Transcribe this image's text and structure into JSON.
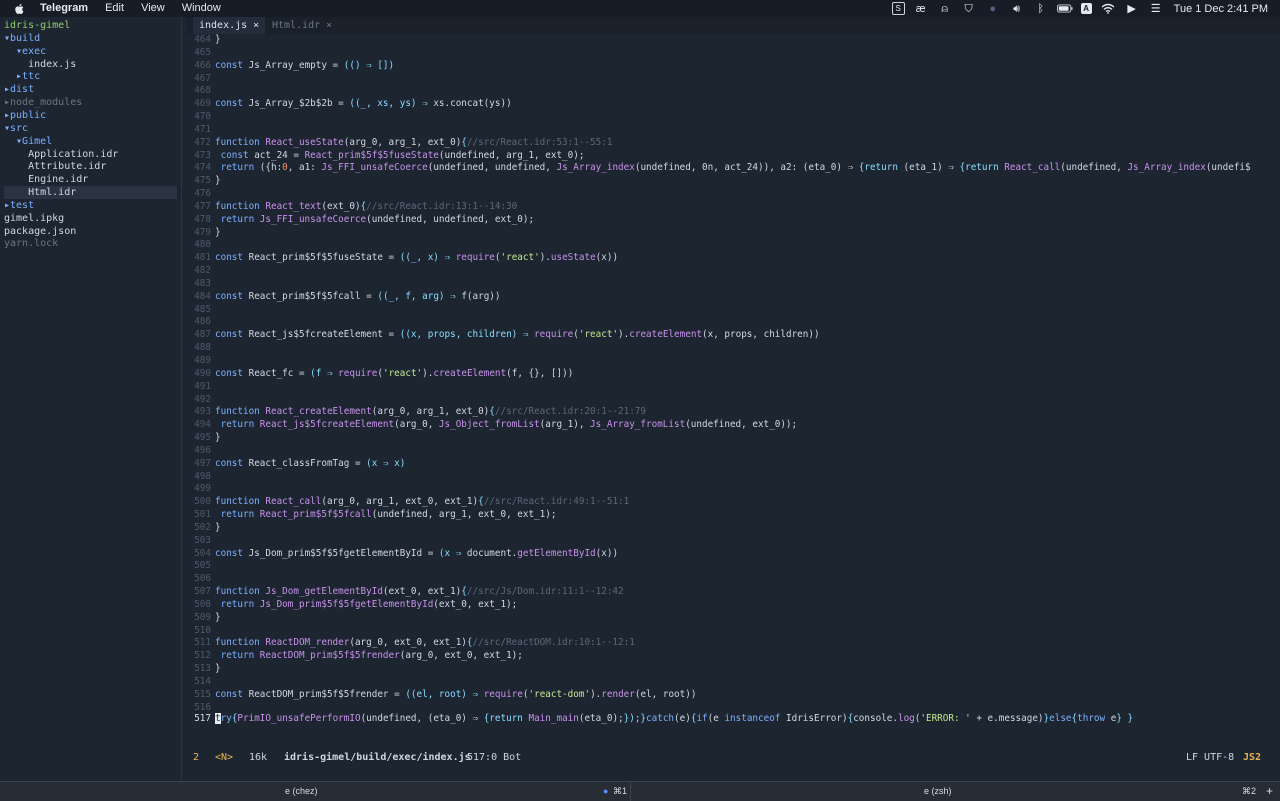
{
  "menubar": {
    "app_name": "Telegram",
    "menus": [
      "Edit",
      "View",
      "Window"
    ],
    "status_icons": [
      "terminal-icon",
      "ae-icon",
      "vpn-icon",
      "shield-icon",
      "circle-icon",
      "volume-icon",
      "bluetooth-icon",
      "battery-icon",
      "input-source-icon",
      "wifi-icon",
      "play-icon",
      "control-center-icon"
    ],
    "clock": "Tue 1 Dec  2:41 PM"
  },
  "sidebar": {
    "items": [
      {
        "label": "idris-gimel",
        "color": "#8fd16b"
      },
      {
        "label": "▾build",
        "color": "#7cb0ff"
      },
      {
        "label": "  ▾exec",
        "color": "#7cb0ff"
      },
      {
        "label": "    index.js",
        "color": "#d1d8e2"
      },
      {
        "label": "  ▸ttc",
        "color": "#7cb0ff"
      },
      {
        "label": "▸dist",
        "color": "#7cb0ff"
      },
      {
        "label": "▸node_modules",
        "color": "#6a7585"
      },
      {
        "label": "▸public",
        "color": "#7cb0ff"
      },
      {
        "label": "▾src",
        "color": "#7cb0ff"
      },
      {
        "label": "  ▾Gimel",
        "color": "#7cb0ff"
      },
      {
        "label": "    Application.idr",
        "color": "#d1d8e2"
      },
      {
        "label": "    Attribute.idr",
        "color": "#d1d8e2"
      },
      {
        "label": "    Engine.idr",
        "color": "#d1d8e2"
      },
      {
        "label": "    Html.idr",
        "color": "#d1d8e2"
      },
      {
        "label": "▸test",
        "color": "#7cb0ff"
      },
      {
        "label": "gimel.ipkg",
        "color": "#d1d8e2"
      },
      {
        "label": "package.json",
        "color": "#d1d8e2"
      },
      {
        "label": "yarn.lock",
        "color": "#6a7585"
      }
    ]
  },
  "tabs": [
    {
      "label": "index.js ×",
      "active": true
    },
    {
      "label": "Html.idr ×",
      "active": false
    }
  ],
  "editor": {
    "lines": [
      {
        "num": "464",
        "segs": [
          {
            "t": "}",
            "c": "code"
          }
        ]
      },
      {
        "num": "465",
        "segs": []
      },
      {
        "num": "466",
        "segs": [
          {
            "t": "const ",
            "c": "k"
          },
          {
            "t": "Js_Array_empty = ",
            "c": "code"
          },
          {
            "t": "(() ⇒ [])",
            "c": "p"
          }
        ]
      },
      {
        "num": "467",
        "segs": []
      },
      {
        "num": "468",
        "segs": []
      },
      {
        "num": "469",
        "segs": [
          {
            "t": "const ",
            "c": "k"
          },
          {
            "t": "Js_Array_$2b$2b = ",
            "c": "code"
          },
          {
            "t": "((_, xs, ys) ⇒ ",
            "c": "p"
          },
          {
            "t": "xs.concat(ys))",
            "c": "code"
          }
        ]
      },
      {
        "num": "470",
        "segs": []
      },
      {
        "num": "471",
        "segs": []
      },
      {
        "num": "472",
        "segs": [
          {
            "t": "function ",
            "c": "k"
          },
          {
            "t": "React_useState",
            "c": "f"
          },
          {
            "t": "(arg_0, arg_1, ext_0)",
            "c": "code"
          },
          {
            "t": "{",
            "c": "p"
          },
          {
            "t": "//src/React.idr:53:1--55:1",
            "c": "c"
          }
        ]
      },
      {
        "num": "473",
        "segs": [
          {
            "t": " const ",
            "c": "k"
          },
          {
            "t": "act_24 = ",
            "c": "code"
          },
          {
            "t": "React_prim$5f$5fuseState",
            "c": "f"
          },
          {
            "t": "(undefined, arg_1, ext_0);",
            "c": "code"
          }
        ]
      },
      {
        "num": "474",
        "segs": [
          {
            "t": " return ",
            "c": "k"
          },
          {
            "t": "({h:",
            "c": "code"
          },
          {
            "t": "0",
            "c": "n"
          },
          {
            "t": ", a1: ",
            "c": "code"
          },
          {
            "t": "Js_FFI_unsafeCoerce",
            "c": "f"
          },
          {
            "t": "(undefined, undefined, ",
            "c": "code"
          },
          {
            "t": "Js_Array_index",
            "c": "f"
          },
          {
            "t": "(undefined, 0n, act_24)), a2: (eta_0) ⇒ ",
            "c": "code"
          },
          {
            "t": "{return ",
            "c": "p"
          },
          {
            "t": "(eta_1) ⇒ ",
            "c": "code"
          },
          {
            "t": "{return ",
            "c": "p"
          },
          {
            "t": "React_call",
            "c": "f"
          },
          {
            "t": "(undefined, ",
            "c": "code"
          },
          {
            "t": "Js_Array_index",
            "c": "f"
          },
          {
            "t": "(undefi$",
            "c": "code"
          }
        ]
      },
      {
        "num": "475",
        "segs": [
          {
            "t": "}",
            "c": "code"
          }
        ]
      },
      {
        "num": "476",
        "segs": []
      },
      {
        "num": "477",
        "segs": [
          {
            "t": "function ",
            "c": "k"
          },
          {
            "t": "React_text",
            "c": "f"
          },
          {
            "t": "(ext_0)",
            "c": "code"
          },
          {
            "t": "{",
            "c": "p"
          },
          {
            "t": "//src/React.idr:13:1--14:30",
            "c": "c"
          }
        ]
      },
      {
        "num": "478",
        "segs": [
          {
            "t": " return ",
            "c": "k"
          },
          {
            "t": "Js_FFI_unsafeCoerce",
            "c": "f"
          },
          {
            "t": "(undefined, undefined, ext_0);",
            "c": "code"
          }
        ]
      },
      {
        "num": "479",
        "segs": [
          {
            "t": "}",
            "c": "code"
          }
        ]
      },
      {
        "num": "480",
        "segs": []
      },
      {
        "num": "481",
        "segs": [
          {
            "t": "const ",
            "c": "k"
          },
          {
            "t": "React_prim$5f$5fuseState = ",
            "c": "code"
          },
          {
            "t": "((_, x) ⇒ ",
            "c": "p"
          },
          {
            "t": "require",
            "c": "f"
          },
          {
            "t": "(",
            "c": "code"
          },
          {
            "t": "'react'",
            "c": "s"
          },
          {
            "t": ").",
            "c": "code"
          },
          {
            "t": "useState",
            "c": "f"
          },
          {
            "t": "(x))",
            "c": "code"
          }
        ]
      },
      {
        "num": "482",
        "segs": []
      },
      {
        "num": "483",
        "segs": []
      },
      {
        "num": "484",
        "segs": [
          {
            "t": "const ",
            "c": "k"
          },
          {
            "t": "React_prim$5f$5fcall = ",
            "c": "code"
          },
          {
            "t": "((_, f, arg) ⇒ ",
            "c": "p"
          },
          {
            "t": "f(arg))",
            "c": "code"
          }
        ]
      },
      {
        "num": "485",
        "segs": []
      },
      {
        "num": "486",
        "segs": []
      },
      {
        "num": "487",
        "segs": [
          {
            "t": "const ",
            "c": "k"
          },
          {
            "t": "React_js$5fcreateElement = ",
            "c": "code"
          },
          {
            "t": "((x, props, children) ⇒ ",
            "c": "p"
          },
          {
            "t": "require",
            "c": "f"
          },
          {
            "t": "(",
            "c": "code"
          },
          {
            "t": "'react'",
            "c": "s"
          },
          {
            "t": ").",
            "c": "code"
          },
          {
            "t": "createElement",
            "c": "f"
          },
          {
            "t": "(x, props, children))",
            "c": "code"
          }
        ]
      },
      {
        "num": "488",
        "segs": []
      },
      {
        "num": "489",
        "segs": []
      },
      {
        "num": "490",
        "segs": [
          {
            "t": "const ",
            "c": "k"
          },
          {
            "t": "React_fc = ",
            "c": "code"
          },
          {
            "t": "(f ⇒ ",
            "c": "p"
          },
          {
            "t": "require",
            "c": "f"
          },
          {
            "t": "(",
            "c": "code"
          },
          {
            "t": "'react'",
            "c": "s"
          },
          {
            "t": ").",
            "c": "code"
          },
          {
            "t": "createElement",
            "c": "f"
          },
          {
            "t": "(f, {}, []))",
            "c": "code"
          }
        ]
      },
      {
        "num": "491",
        "segs": []
      },
      {
        "num": "492",
        "segs": []
      },
      {
        "num": "493",
        "segs": [
          {
            "t": "function ",
            "c": "k"
          },
          {
            "t": "React_createElement",
            "c": "f"
          },
          {
            "t": "(arg_0, arg_1, ext_0)",
            "c": "code"
          },
          {
            "t": "{",
            "c": "p"
          },
          {
            "t": "//src/React.idr:20:1--21:79",
            "c": "c"
          }
        ]
      },
      {
        "num": "494",
        "segs": [
          {
            "t": " return ",
            "c": "k"
          },
          {
            "t": "React_js$5fcreateElement",
            "c": "f"
          },
          {
            "t": "(arg_0, ",
            "c": "code"
          },
          {
            "t": "Js_Object_fromList",
            "c": "f"
          },
          {
            "t": "(arg_1), ",
            "c": "code"
          },
          {
            "t": "Js_Array_fromList",
            "c": "f"
          },
          {
            "t": "(undefined, ext_0));",
            "c": "code"
          }
        ]
      },
      {
        "num": "495",
        "segs": [
          {
            "t": "}",
            "c": "code"
          }
        ]
      },
      {
        "num": "496",
        "segs": []
      },
      {
        "num": "497",
        "segs": [
          {
            "t": "const ",
            "c": "k"
          },
          {
            "t": "React_classFromTag = ",
            "c": "code"
          },
          {
            "t": "(x ⇒ x)",
            "c": "p"
          }
        ]
      },
      {
        "num": "498",
        "segs": []
      },
      {
        "num": "499",
        "segs": []
      },
      {
        "num": "500",
        "segs": [
          {
            "t": "function ",
            "c": "k"
          },
          {
            "t": "React_call",
            "c": "f"
          },
          {
            "t": "(arg_0, arg_1, ext_0, ext_1)",
            "c": "code"
          },
          {
            "t": "{",
            "c": "p"
          },
          {
            "t": "//src/React.idr:49:1--51:1",
            "c": "c"
          }
        ]
      },
      {
        "num": "501",
        "segs": [
          {
            "t": " return ",
            "c": "k"
          },
          {
            "t": "React_prim$5f$5fcall",
            "c": "f"
          },
          {
            "t": "(undefined, arg_1, ext_0, ext_1);",
            "c": "code"
          }
        ]
      },
      {
        "num": "502",
        "segs": [
          {
            "t": "}",
            "c": "code"
          }
        ]
      },
      {
        "num": "503",
        "segs": []
      },
      {
        "num": "504",
        "segs": [
          {
            "t": "const ",
            "c": "k"
          },
          {
            "t": "Js_Dom_prim$5f$5fgetElementById = ",
            "c": "code"
          },
          {
            "t": "(x ⇒ ",
            "c": "p"
          },
          {
            "t": "document.",
            "c": "code"
          },
          {
            "t": "getElementById",
            "c": "f"
          },
          {
            "t": "(x))",
            "c": "code"
          }
        ]
      },
      {
        "num": "505",
        "segs": []
      },
      {
        "num": "506",
        "segs": []
      },
      {
        "num": "507",
        "segs": [
          {
            "t": "function ",
            "c": "k"
          },
          {
            "t": "Js_Dom_getElementById",
            "c": "f"
          },
          {
            "t": "(ext_0, ext_1)",
            "c": "code"
          },
          {
            "t": "{",
            "c": "p"
          },
          {
            "t": "//src/Js/Dom.idr:11:1--12:42",
            "c": "c"
          }
        ]
      },
      {
        "num": "508",
        "segs": [
          {
            "t": " return ",
            "c": "k"
          },
          {
            "t": "Js_Dom_prim$5f$5fgetElementById",
            "c": "f"
          },
          {
            "t": "(ext_0, ext_1);",
            "c": "code"
          }
        ]
      },
      {
        "num": "509",
        "segs": [
          {
            "t": "}",
            "c": "code"
          }
        ]
      },
      {
        "num": "510",
        "segs": []
      },
      {
        "num": "511",
        "segs": [
          {
            "t": "function ",
            "c": "k"
          },
          {
            "t": "ReactDOM_render",
            "c": "f"
          },
          {
            "t": "(arg_0, ext_0, ext_1)",
            "c": "code"
          },
          {
            "t": "{",
            "c": "p"
          },
          {
            "t": "//src/ReactDOM.idr:10:1--12:1",
            "c": "c"
          }
        ]
      },
      {
        "num": "512",
        "segs": [
          {
            "t": " return ",
            "c": "k"
          },
          {
            "t": "ReactDOM_prim$5f$5frender",
            "c": "f"
          },
          {
            "t": "(arg_0, ext_0, ext_1);",
            "c": "code"
          }
        ]
      },
      {
        "num": "513",
        "segs": [
          {
            "t": "}",
            "c": "code"
          }
        ]
      },
      {
        "num": "514",
        "segs": []
      },
      {
        "num": "515",
        "segs": [
          {
            "t": "const ",
            "c": "k"
          },
          {
            "t": "ReactDOM_prim$5f$5frender = ",
            "c": "code"
          },
          {
            "t": "((el, root) ⇒ ",
            "c": "p"
          },
          {
            "t": "require",
            "c": "f"
          },
          {
            "t": "(",
            "c": "code"
          },
          {
            "t": "'react-dom'",
            "c": "s"
          },
          {
            "t": ").",
            "c": "code"
          },
          {
            "t": "render",
            "c": "f"
          },
          {
            "t": "(el, root))",
            "c": "code"
          }
        ]
      },
      {
        "num": "516",
        "segs": []
      },
      {
        "num": "517",
        "current": true,
        "segs": [
          {
            "t": "t",
            "c": "cursor"
          },
          {
            "t": "ry",
            "c": "k"
          },
          {
            "t": "{",
            "c": "p"
          },
          {
            "t": "PrimIO_unsafePerformIO",
            "c": "f"
          },
          {
            "t": "(undefined, (eta_0) ⇒ ",
            "c": "code"
          },
          {
            "t": "{return ",
            "c": "p"
          },
          {
            "t": "Main_main",
            "c": "f"
          },
          {
            "t": "(eta_0);",
            "c": "code"
          },
          {
            "t": "});}",
            "c": "p"
          },
          {
            "t": "catch",
            "c": "k"
          },
          {
            "t": "(e)",
            "c": "code"
          },
          {
            "t": "{",
            "c": "p"
          },
          {
            "t": "if",
            "c": "k"
          },
          {
            "t": "(e ",
            "c": "code"
          },
          {
            "t": "instanceof ",
            "c": "k"
          },
          {
            "t": "IdrisError)",
            "c": "code"
          },
          {
            "t": "{",
            "c": "p"
          },
          {
            "t": "console.",
            "c": "code"
          },
          {
            "t": "log",
            "c": "f"
          },
          {
            "t": "(",
            "c": "code"
          },
          {
            "t": "'ERROR: '",
            "c": "s"
          },
          {
            "t": " + e.message)",
            "c": "code"
          },
          {
            "t": "}",
            "c": "p"
          },
          {
            "t": "else",
            "c": "k"
          },
          {
            "t": "{",
            "c": "p"
          },
          {
            "t": "throw ",
            "c": "k"
          },
          {
            "t": "e",
            "c": "code"
          },
          {
            "t": "} }",
            "c": "p"
          }
        ]
      }
    ]
  },
  "statusline": {
    "buffer_num": "2",
    "mode": "<N>",
    "size": "16k",
    "path": "idris-gimel/build/exec/index.js",
    "position": "517:0 Bot",
    "encoding": "LF UTF-8",
    "filetype": "JS2"
  },
  "tmux": {
    "left_title": "e (chez)",
    "left_shortcut": "⌘1",
    "right_title": "e (zsh)",
    "right_shortcut": "⌘2",
    "add": "+"
  }
}
